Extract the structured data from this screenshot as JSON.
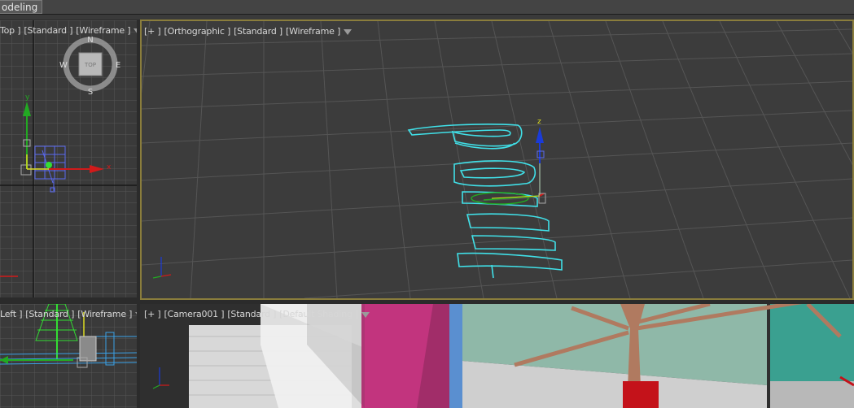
{
  "ribbon": {
    "tab_label": "odeling"
  },
  "viewports": {
    "top": {
      "label": [
        "Top ]",
        "[Standard ]",
        "[Wireframe ]"
      ],
      "viewcube": {
        "top_face": "TOP",
        "north": "N",
        "south": "S",
        "east": "E",
        "west": "W"
      },
      "axis_labels": {
        "y": "y",
        "x": "x"
      }
    },
    "perspective": {
      "label": [
        "[+ ]",
        "[Orthographic ]",
        "[Standard ]",
        "[Wireframe ]"
      ],
      "gizmo_axis": "z",
      "object_text": "paint"
    },
    "left": {
      "label": [
        "Left ]",
        "[Standard ]",
        "[Wireframe ]"
      ]
    },
    "camera": {
      "label": [
        "[+ ]",
        "[Camera001 ]",
        "[Standard ]",
        "[Default Shading ]"
      ]
    }
  },
  "colors": {
    "active_border": "#8a7d3c",
    "selection": "#40e0e8",
    "axis_x": "#d11a1a",
    "axis_y": "#22aa22",
    "axis_z": "#1a3bd8"
  },
  "icons": [
    "filter-icon",
    "viewcube-icon",
    "move-gizmo-icon",
    "axis-tripod-icon"
  ]
}
